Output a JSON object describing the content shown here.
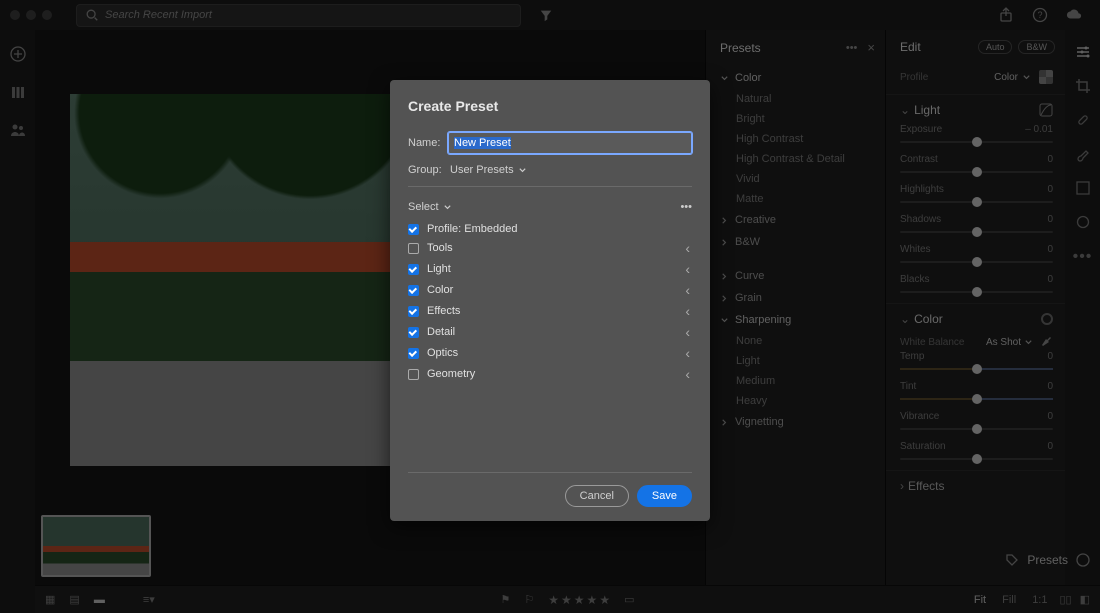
{
  "topbar": {
    "search_placeholder": "Search Recent Import"
  },
  "presets_panel": {
    "title": "Presets",
    "sections": {
      "color": {
        "label": "Color",
        "items": [
          "Natural",
          "Bright",
          "High Contrast",
          "High Contrast & Detail",
          "Vivid",
          "Matte"
        ]
      },
      "creative": {
        "label": "Creative"
      },
      "bw": {
        "label": "B&W"
      },
      "curve": {
        "label": "Curve"
      },
      "grain": {
        "label": "Grain"
      },
      "sharpening": {
        "label": "Sharpening",
        "items": [
          "None",
          "Light",
          "Medium",
          "Heavy"
        ]
      },
      "vignetting": {
        "label": "Vignetting"
      }
    }
  },
  "edit_panel": {
    "title": "Edit",
    "auto": "Auto",
    "bw": "B&W",
    "profile": {
      "label": "Profile",
      "value": "Color"
    },
    "light": {
      "label": "Light",
      "exposure": {
        "label": "Exposure",
        "value": "– 0.01"
      },
      "contrast": {
        "label": "Contrast",
        "value": "0"
      },
      "highlights": {
        "label": "Highlights",
        "value": "0"
      },
      "shadows": {
        "label": "Shadows",
        "value": "0"
      },
      "whites": {
        "label": "Whites",
        "value": "0"
      },
      "blacks": {
        "label": "Blacks",
        "value": "0"
      }
    },
    "color": {
      "label": "Color",
      "wb": {
        "label": "White Balance",
        "value": "As Shot"
      },
      "temp": {
        "label": "Temp",
        "value": "0"
      },
      "tint": {
        "label": "Tint",
        "value": "0"
      },
      "vibrance": {
        "label": "Vibrance",
        "value": "0"
      },
      "saturation": {
        "label": "Saturation",
        "value": "0"
      }
    },
    "effects": {
      "label": "Effects"
    }
  },
  "bottombar": {
    "fit": "Fit",
    "fill": "Fill",
    "oneone": "1:1",
    "presets": "Presets"
  },
  "dialog": {
    "title": "Create Preset",
    "name_label": "Name:",
    "name_value": "New Preset",
    "group_label": "Group:",
    "group_value": "User Presets",
    "select_label": "Select",
    "items": {
      "profile": "Profile: Embedded",
      "tools": "Tools",
      "light": "Light",
      "color": "Color",
      "effects": "Effects",
      "detail": "Detail",
      "optics": "Optics",
      "geometry": "Geometry"
    },
    "cancel": "Cancel",
    "save": "Save"
  }
}
